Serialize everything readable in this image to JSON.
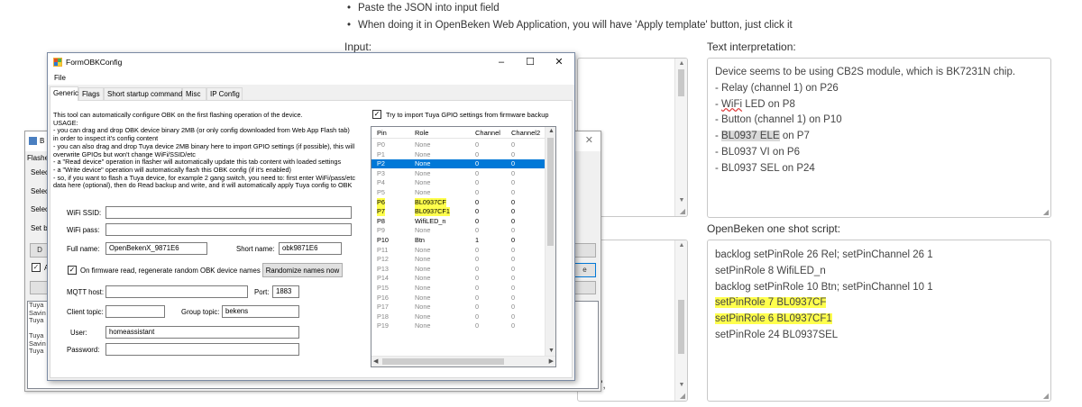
{
  "instructions": {
    "items": [
      "Paste the JSON into input field",
      "When doing it in OpenBeken Web Application, you will have 'Apply template' button, just click it"
    ]
  },
  "input_section": {
    "label": "Input:"
  },
  "text_interpretation": {
    "label": "Text interpretation:",
    "intro": "Device seems to be using CB2S module, which is BK7231N chip.",
    "lines": [
      "- Relay (channel 1) on P26",
      {
        "pre": "- ",
        "squiggle": "WiFi",
        "post": " LED on P8"
      },
      "- Button (channel 1) on P10",
      {
        "pre": "- ",
        "selected": "BL0937 ELE",
        "post": " on P7"
      },
      "- BL0937 VI on P6",
      "- BL0937 SEL on P24"
    ]
  },
  "script_section": {
    "label": "OpenBeken one shot script:",
    "lines": [
      {
        "text": "backlog setPinRole 26 Rel; setPinChannel 26 1",
        "highlight": false
      },
      {
        "text": "setPinRole 8 WifiLED_n",
        "highlight": false
      },
      {
        "text": "backlog setPinRole 10 Btn; setPinChannel 10 1",
        "highlight": false
      },
      {
        "text": "setPinRole 7 BL0937CF",
        "highlight": true
      },
      {
        "text": "setPinRole 6 BL0937CF1",
        "highlight": true
      },
      {
        "text": "setPinRole 24 BL0937SEL",
        "highlight": false
      }
    ]
  },
  "behind_text": {
    "fragment": "g\","
  },
  "background_window": {
    "title_frag": "B",
    "label_flash": "Flashe",
    "labels": [
      "Selec",
      "Selec",
      "Selec",
      "Set b"
    ],
    "btn_d": "D",
    "check_frag": "A",
    "button_right_frag": "e",
    "log_lines": [
      "Tuya",
      "Savin",
      "Tuya",
      "",
      "Tuya",
      "Savin",
      "Tuya"
    ]
  },
  "dialog": {
    "title": "FormOBKConfig",
    "controls": {
      "minimize": "–",
      "maximize": "☐",
      "close": "✕"
    },
    "menu_file": "File",
    "tabs": [
      "Generic",
      "Flags",
      "Short startup command",
      "Misc",
      "IP Config"
    ],
    "active_tab": 0,
    "description_lines": [
      "This tool can automatically configure OBK on the first flashing operation of the device.",
      "USAGE:",
      "- you can drag and drop OBK device binary 2MB (or only config downloaded from Web App Flash tab)",
      "  in order to inspect it's config content",
      "- you can also drag and drop Tuya device 2MB binary here to import GPIO settings (if possible), this will",
      "  overwrite GPIOs but won't change WiFi/SSID/etc",
      "- a \"Read device\" operation in flasher will automatically update this tab content with loaded settings",
      "- a \"Write device\" operation will automatically flash this OBK config (if it's enabled)",
      "- so, if you want to flash a Tuya device, for example 2 gang switch, you need to: first enter WiFi/pass/etc",
      "  data here (optional), then do Read backup and write, and it will automatically apply Tuya config to OBK"
    ],
    "import_checkbox": {
      "label": "Try to import Tuya GPIO settings from firmware backup",
      "checked": "✓"
    },
    "wifi_ssid": {
      "label": "WiFi SSID:",
      "value": ""
    },
    "wifi_pass": {
      "label": "WiFi pass:",
      "value": ""
    },
    "full_name": {
      "label": "Full name:",
      "value": "OpenBekenX_9871E6"
    },
    "short_name": {
      "label": "Short name:",
      "value": "obk9871E6"
    },
    "regen_checkbox": {
      "label": "On firmware read, regenerate random OBK device names",
      "checked": "✓"
    },
    "randomize_button": "Randomize names now",
    "mqtt_host": {
      "label": "MQTT host:",
      "value": ""
    },
    "port": {
      "label": "Port:",
      "value": "1883"
    },
    "client_topic": {
      "label": "Client topic:",
      "value": ""
    },
    "group_topic": {
      "label": "Group topic:",
      "value": "bekens"
    },
    "user": {
      "label": "User:",
      "value": "homeassistant"
    },
    "password": {
      "label": "Password:",
      "value": ""
    }
  },
  "gpio_grid": {
    "headers": [
      "Pin",
      "Role",
      "Channel",
      "Channel2"
    ],
    "rows": [
      {
        "pin": "P0",
        "role": "None",
        "ch": "0",
        "ch2": "0",
        "style": "normal"
      },
      {
        "pin": "P1",
        "role": "None",
        "ch": "0",
        "ch2": "0",
        "style": "normal"
      },
      {
        "pin": "P2",
        "role": "None",
        "ch": "0",
        "ch2": "0",
        "style": "selected"
      },
      {
        "pin": "P3",
        "role": "None",
        "ch": "0",
        "ch2": "0",
        "style": "normal"
      },
      {
        "pin": "P4",
        "role": "None",
        "ch": "0",
        "ch2": "0",
        "style": "normal"
      },
      {
        "pin": "P5",
        "role": "None",
        "ch": "0",
        "ch2": "0",
        "style": "normal"
      },
      {
        "pin": "P6",
        "role": "BL0937CF",
        "ch": "0",
        "ch2": "0",
        "style": "highlight"
      },
      {
        "pin": "P7",
        "role": "BL0937CF1",
        "ch": "0",
        "ch2": "0",
        "style": "highlight"
      },
      {
        "pin": "P8",
        "role": "WifiLED_n",
        "ch": "0",
        "ch2": "0",
        "style": "bold"
      },
      {
        "pin": "P9",
        "role": "None",
        "ch": "0",
        "ch2": "0",
        "style": "normal"
      },
      {
        "pin": "P10",
        "role": "Btn",
        "ch": "1",
        "ch2": "0",
        "style": "bold"
      },
      {
        "pin": "P11",
        "role": "None",
        "ch": "0",
        "ch2": "0",
        "style": "normal"
      },
      {
        "pin": "P12",
        "role": "None",
        "ch": "0",
        "ch2": "0",
        "style": "normal"
      },
      {
        "pin": "P13",
        "role": "None",
        "ch": "0",
        "ch2": "0",
        "style": "normal"
      },
      {
        "pin": "P14",
        "role": "None",
        "ch": "0",
        "ch2": "0",
        "style": "normal"
      },
      {
        "pin": "P15",
        "role": "None",
        "ch": "0",
        "ch2": "0",
        "style": "normal"
      },
      {
        "pin": "P16",
        "role": "None",
        "ch": "0",
        "ch2": "0",
        "style": "normal"
      },
      {
        "pin": "P17",
        "role": "None",
        "ch": "0",
        "ch2": "0",
        "style": "normal"
      },
      {
        "pin": "P18",
        "role": "None",
        "ch": "0",
        "ch2": "0",
        "style": "normal"
      },
      {
        "pin": "P19",
        "role": "None",
        "ch": "0",
        "ch2": "0",
        "style": "normal"
      }
    ]
  },
  "colors": {
    "highlight": "#ffff4d",
    "selection": "#0078d7"
  }
}
